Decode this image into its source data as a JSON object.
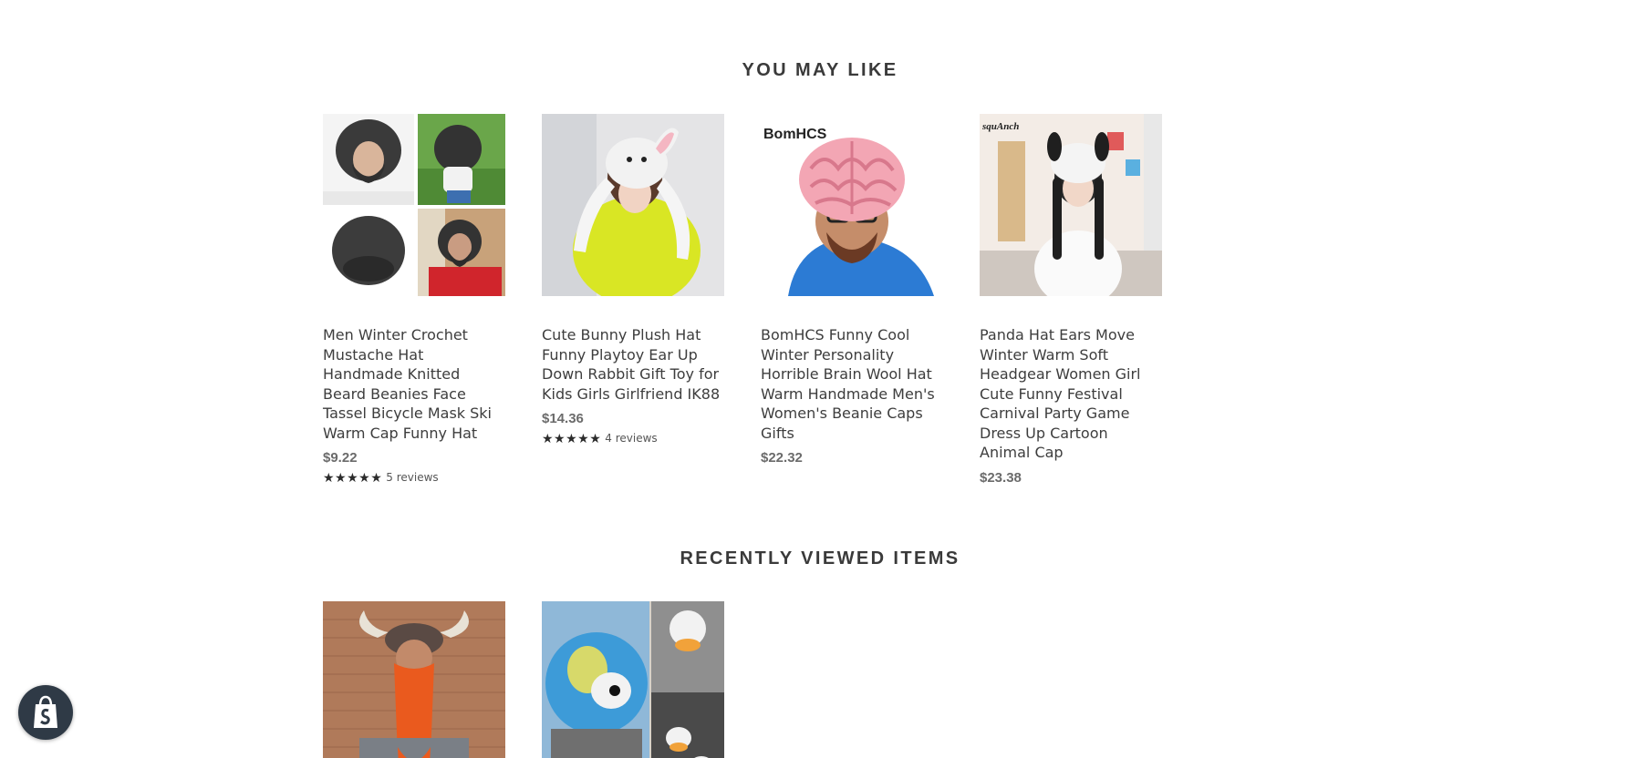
{
  "sections": {
    "you_may_like": {
      "title": "YOU MAY LIKE",
      "products": [
        {
          "title": "Men Winter Crochet Mustache Hat Handmade Knitted Beard Beanies Face Tassel Bicycle Mask Ski Warm Cap Funny Hat",
          "price": "$9.22",
          "rating": 5,
          "stars": "★★★★★",
          "reviews": "5 reviews"
        },
        {
          "title": "Cute Bunny Plush Hat Funny Playtoy Ear Up Down Rabbit Gift Toy for Kids Girls Girlfriend IK88",
          "price": "$14.36",
          "rating": 5,
          "stars": "★★★★★",
          "reviews": "4 reviews"
        },
        {
          "title": "BomHCS Funny Cool Winter Personality Horrible Brain Wool Hat Warm Handmade Men's Women's Beanie Caps Gifts",
          "price": "$22.32",
          "image_text": "BomHCS"
        },
        {
          "title": "Panda Hat Ears Move Winter Warm Soft Headgear Women Girl Cute Funny Festival Carnival Party Game Dress Up Cartoon Animal Cap",
          "price": "$23.38",
          "image_text": "squAnch"
        }
      ]
    },
    "recently_viewed": {
      "title": "RECENTLY VIEWED ITEMS"
    }
  },
  "shopify_badge": {
    "icon": "shopify-bag-icon"
  },
  "colors": {
    "text": "#3a3a3a",
    "price": "#6b6b6b",
    "badge_bg": "#2f3a46"
  }
}
